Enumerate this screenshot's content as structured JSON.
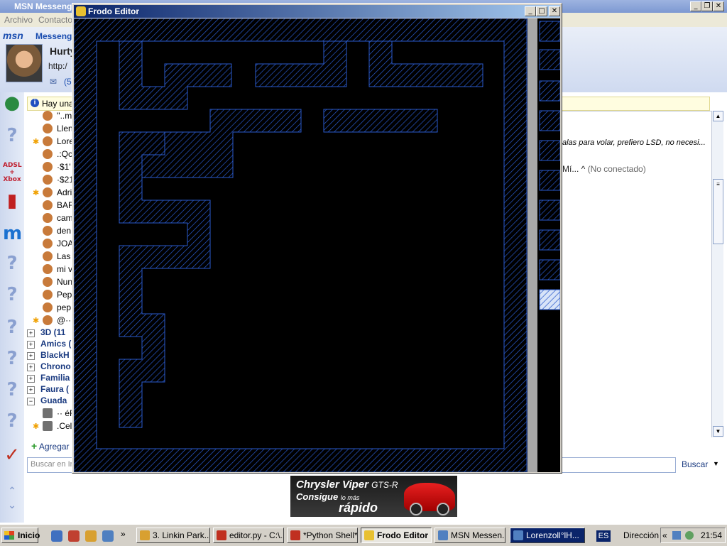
{
  "msn": {
    "title": "MSN Messeng",
    "menu": [
      "Archivo",
      "Contacto"
    ],
    "logo": "msn",
    "logo_text": "Messeng",
    "user_name": "Hurty",
    "user_url": "http:/",
    "mail_count": "(5",
    "info_text": "Hay una",
    "contacts": [
      {
        "name": "''..m",
        "star": false
      },
      {
        "name": "Llen",
        "star": false
      },
      {
        "name": "Lore",
        "star": true
      },
      {
        "name": ".:Qc",
        "star": false
      },
      {
        "name": "·$1'",
        "star": false
      },
      {
        "name": "·$21",
        "star": false
      },
      {
        "name": "Adri",
        "star": true
      },
      {
        "name": "BAF",
        "star": false
      },
      {
        "name": "cam",
        "star": false
      },
      {
        "name": "den",
        "star": false
      },
      {
        "name": "JOA",
        "star": false
      },
      {
        "name": "Las",
        "star": false
      },
      {
        "name": "mi v",
        "star": false
      },
      {
        "name": "Nun",
        "star": false
      },
      {
        "name": "Pep",
        "star": false
      },
      {
        "name": "pep",
        "star": false
      },
      {
        "name": "@··",
        "star": true
      }
    ],
    "groups": [
      {
        "name": "3D (11",
        "sign": "+"
      },
      {
        "name": "Amics (",
        "sign": "+"
      },
      {
        "name": "BlackH",
        "sign": "+"
      },
      {
        "name": "Chrono",
        "sign": "+"
      },
      {
        "name": "Familia",
        "sign": "+"
      },
      {
        "name": "Faura (",
        "sign": "+"
      },
      {
        "name": "Guada",
        "sign": "−"
      }
    ],
    "guada_items": [
      {
        "name": "·· éR",
        "star": false
      },
      {
        "name": ".Cel",
        "star": true
      }
    ],
    "add_contact": "Agregar",
    "search_placeholder": "Buscar en Ir",
    "quote": "alas para volar, prefiero LSD, no necesi...",
    "offline_name": "Mí... ^",
    "offline_status": "(No conectado)",
    "buscar": "Buscar",
    "ad": {
      "line1": "Chrysler Viper",
      "line1_suffix": "GTS-R",
      "line2": "Consigue",
      "line2_small": "lo más",
      "line3": "rápido"
    }
  },
  "frodo": {
    "title": "Frodo Editor"
  },
  "taskbar": {
    "start": "Inicio",
    "tasks": [
      {
        "label": "3. Linkin Park...",
        "color": "#d8a030",
        "active": false,
        "dark": false
      },
      {
        "label": "editor.py - C:\\...",
        "color": "#c03020",
        "active": false,
        "dark": false
      },
      {
        "label": "*Python Shell*",
        "color": "#c03020",
        "active": false,
        "dark": false
      },
      {
        "label": "Frodo Editor",
        "color": "#e8c030",
        "active": true,
        "dark": false
      },
      {
        "label": "MSN Messen...",
        "color": "#5080c0",
        "active": false,
        "dark": false
      },
      {
        "label": "Lorenzoll°lH...",
        "color": "#5080c0",
        "active": false,
        "dark": true
      }
    ],
    "lang": "ES",
    "address_label": "Dirección",
    "clock": "21:54"
  },
  "colors": {
    "wall_stroke": "#2a5acc",
    "editor_bg": "#000000",
    "titlebar_active": "#0a246a"
  }
}
